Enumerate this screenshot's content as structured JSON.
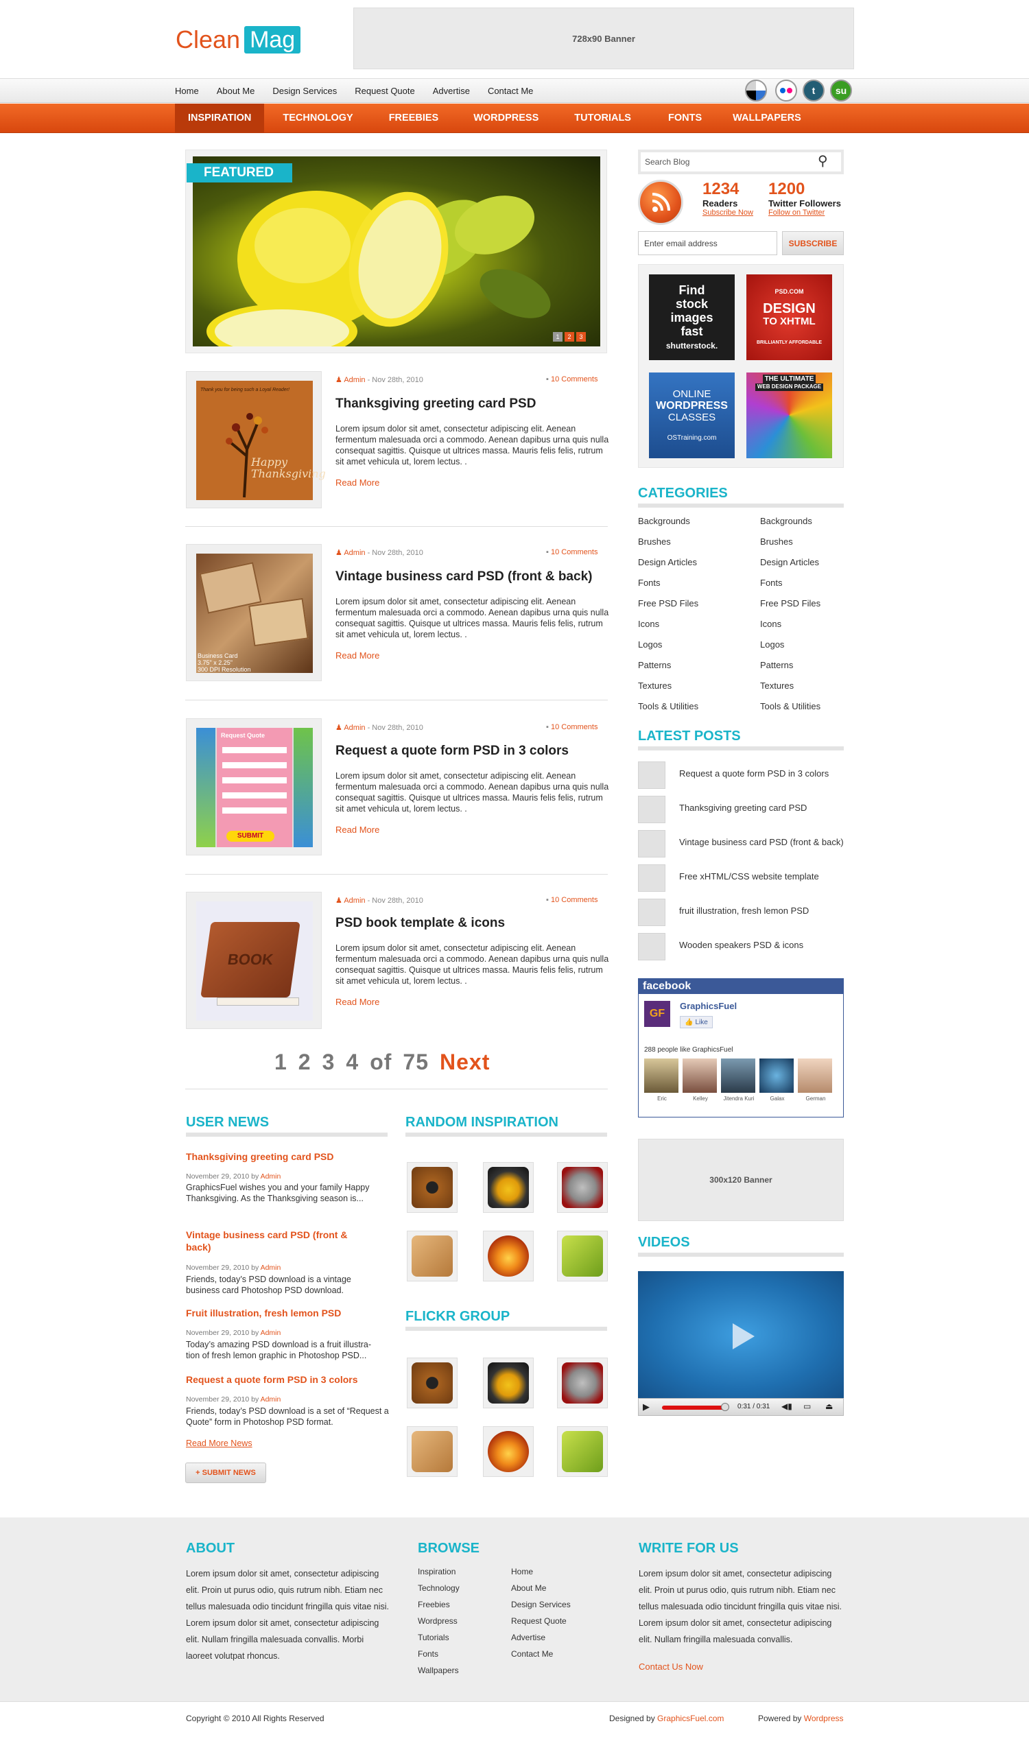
{
  "header": {
    "logo_part1": "Clean",
    "logo_part2": "Mag",
    "banner_text": "728x90 Banner"
  },
  "top_links": [
    "Home",
    "About Me",
    "Design Services",
    "Request Quote",
    "Advertise",
    "Contact Me"
  ],
  "social_icons": [
    "delicious-icon",
    "flickr-icon",
    "technorati-icon",
    "stumbleupon-icon"
  ],
  "nav": {
    "items": [
      "INSPIRATION",
      "TECHNOLOGY",
      "FREEBIES",
      "WORDPRESS",
      "TUTORIALS",
      "FONTS",
      "WALLPAPERS"
    ],
    "active": "INSPIRATION"
  },
  "featured": {
    "tag": "FEATURED",
    "pages": [
      "1",
      "2",
      "3"
    ]
  },
  "posts": [
    {
      "author": "Admin",
      "date": " - Nov 28th, 2010",
      "comments": "10 Comments",
      "title": "Thanksgiving greeting card PSD",
      "body": "Lorem ipsum dolor sit amet, consectetur adipiscing elit. Aenean fermentum malesuada orci a commodo. Aenean dapibus urna quis nulla consequat sagittis. Quisque ut ultrices massa. Mauris felis felis, rutrum sit amet vehicula ut, lorem lectus. .",
      "read_more": "Read More"
    },
    {
      "author": "Admin",
      "date": " - Nov 28th, 2010",
      "comments": "10 Comments",
      "title": "Vintage business card PSD (front & back)",
      "body": "Lorem ipsum dolor sit amet, consectetur adipiscing elit. Aenean fermentum malesuada orci a commodo. Aenean dapibus urna quis nulla consequat sagittis. Quisque ut ultrices massa. Mauris felis felis, rutrum sit amet vehicula ut, lorem lectus. .",
      "read_more": "Read More"
    },
    {
      "author": "Admin",
      "date": " - Nov 28th, 2010",
      "comments": "10 Comments",
      "title": "Request a quote form PSD in 3 colors",
      "body": "Lorem ipsum dolor sit amet, consectetur adipiscing elit. Aenean fermentum malesuada orci a commodo. Aenean dapibus urna quis nulla consequat sagittis. Quisque ut ultrices massa. Mauris felis felis, rutrum sit amet vehicula ut, lorem lectus. .",
      "read_more": "Read More"
    },
    {
      "author": "Admin",
      "date": " - Nov 28th, 2010",
      "comments": "10 Comments",
      "title": "PSD book template & icons",
      "body": "Lorem ipsum dolor sit amet, consectetur adipiscing elit. Aenean fermentum malesuada orci a commodo. Aenean dapibus urna quis nulla consequat sagittis. Quisque ut ultrices massa. Mauris felis felis, rutrum sit amet vehicula ut, lorem lectus. .",
      "read_more": "Read More"
    }
  ],
  "thumb_texts": {
    "thanksgiving_top": "Thank you for being such a Loyal Reader!",
    "thanksgiving_card": "Happy Thanksgiving",
    "business_card": "Business Card",
    "business_size": "3.75\" x 2.25\"",
    "business_res": "300 DPI Resolution",
    "quote_header": "Request Quote",
    "quote_submit": "SUBMIT",
    "book": "BOOK"
  },
  "pagination": {
    "pages": [
      "1",
      "2",
      "3",
      "4"
    ],
    "of": "of",
    "total": "75",
    "next": "Next"
  },
  "user_news": {
    "heading": "USER NEWS",
    "items": [
      {
        "title": "Thanksgiving greeting card PSD",
        "date": "November 29, 2010 by ",
        "author": "Admin",
        "body": "GraphicsFuel wishes you and your family Happy Thanksgiving. As the Thanksgiving season is..."
      },
      {
        "title": "Vintage business card PSD (front & back)",
        "date": "November 29, 2010 by ",
        "author": "Admin",
        "body": "Friends, today’s PSD download is a vintage business card Photoshop PSD download."
      },
      {
        "title": "Fruit illustration, fresh lemon PSD",
        "date": "November 29, 2010 by ",
        "author": "Admin",
        "body": "Today’s amazing PSD download is a fruit illustra-tion of fresh lemon graphic in Photoshop PSD..."
      },
      {
        "title": "Request a quote form PSD in 3 colors",
        "date": "November 29, 2010 by ",
        "author": "Admin",
        "body": "Friends, today’s PSD download is a set of “Request a Quote” form in Photoshop PSD format."
      }
    ],
    "read_more": "Read More News",
    "submit": "+ SUBMIT NEWS"
  },
  "random_inspiration": {
    "heading": "RANDOM INSPIRATION",
    "icons": [
      "speaker-icon",
      "lantern-icon",
      "robot-icon",
      "box-icon",
      "pumpkin-icon",
      "book-icon"
    ]
  },
  "flickr_group": {
    "heading": "FLICKR GROUP",
    "icons": [
      "speaker-icon",
      "lantern-icon",
      "robot-icon",
      "box-icon",
      "pumpkin-icon",
      "book-icon"
    ]
  },
  "sidebar": {
    "search_placeholder": "Search Blog",
    "readers_count": "1234",
    "readers_label": "Readers",
    "readers_link": "Subscribe Now",
    "twitter_count": "1200",
    "twitter_label": "Twitter Followers",
    "twitter_link": "Follow on Twitter",
    "email_placeholder": "Enter email address",
    "subscribe": "SUBSCRIBE",
    "ads": [
      {
        "line1": "Find",
        "line2": "stock",
        "line3": "images",
        "line4": "fast",
        "line5": "shutterstock."
      },
      {
        "line1": "PSD.COM",
        "line2": "DESIGN",
        "line3": "TO XHTML",
        "line4": "BRILLIANTLY AFFORDABLE"
      },
      {
        "line1": "ONLINE",
        "line2": "WORDPRESS",
        "line3": "CLASSES",
        "line4": "OSTraining.com"
      },
      {
        "line1": "THE ULTIMATE",
        "line2": "WEB DESIGN PACKAGE"
      }
    ],
    "categories_heading": "CATEGORIES",
    "categories": [
      "Backgrounds",
      "Brushes",
      "Design Articles",
      "Fonts",
      "Free PSD Files",
      "Icons",
      "Logos",
      "Patterns",
      "Textures",
      "Tools & Utilities"
    ],
    "latest_heading": "LATEST POSTS",
    "latest": [
      "Request a quote form PSD in 3 colors",
      "Thanksgiving greeting card PSD",
      "Vintage business card PSD (front & back)",
      "Free xHTML/CSS website template",
      "fruit illustration, fresh lemon PSD",
      "Wooden speakers PSD & icons"
    ],
    "facebook": {
      "brand": "facebook",
      "page": "GraphicsFuel",
      "page_initials": "GF",
      "like": "Like",
      "count_text": "288 people like GraphicsFuel",
      "fans": [
        "Eric",
        "Kelley",
        "Jitendra Kuri",
        "Galax",
        "German"
      ]
    },
    "banner_text": "300x120 Banner",
    "videos_heading": "VIDEOS",
    "video_time": "0:31 / 0:31"
  },
  "footer": {
    "about_heading": "ABOUT",
    "about_body": "Lorem ipsum dolor sit amet, consectetur adipiscing elit. Proin ut purus odio, quis rutrum nibh. Etiam nec tellus malesuada odio tincidunt fringilla quis vitae nisi. Lorem ipsum dolor sit amet, consectetur adipiscing elit. Nullam fringilla malesuada convallis. Morbi laoreet volutpat rhoncus.",
    "browse_heading": "BROWSE",
    "browse_col1": [
      "Inspiration",
      "Technology",
      "Freebies",
      "Wordpress",
      "Tutorials",
      "Fonts",
      "Wallpapers"
    ],
    "browse_col2": [
      "Home",
      "About Me",
      "Design Services",
      "Request Quote",
      "Advertise",
      "Contact Me"
    ],
    "write_heading": "WRITE FOR US",
    "write_body": "Lorem ipsum dolor sit amet, consectetur adipiscing elit. Proin ut purus odio, quis rutrum nibh. Etiam nec tellus malesuada odio tincidunt fringilla quis vitae nisi. Lorem ipsum dolor sit amet, consectetur adipiscing elit. Nullam fringilla malesuada convallis.",
    "contact_link": "Contact Us Now",
    "copyright": "Copyright © 2010 All Rights Reserved",
    "designed_by": "Designed by ",
    "designed_link": "GraphicsFuel.com",
    "powered_by": "Powered by ",
    "powered_link": "Wordpress"
  },
  "colors": {
    "accent_orange": "#e2531c",
    "accent_teal": "#1ab4c9",
    "facebook_blue": "#3b5998"
  }
}
